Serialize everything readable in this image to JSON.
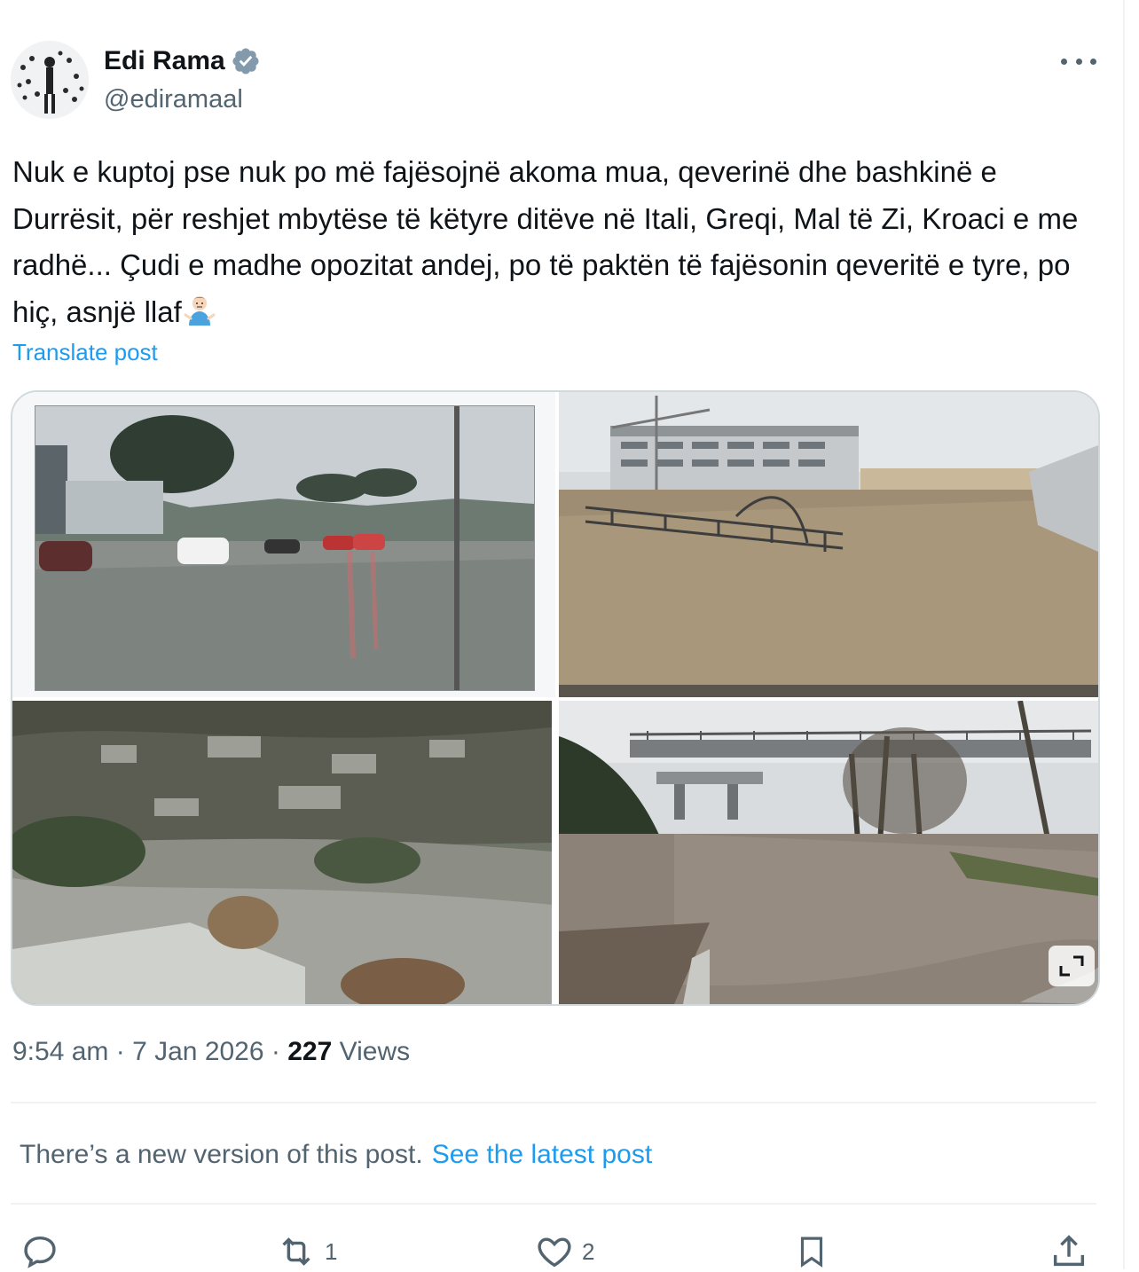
{
  "post": {
    "author": {
      "display_name": "Edi Rama",
      "handle": "@ediramaal",
      "verified": true
    },
    "text": "Nuk e kuptoj pse nuk po më fajësojnë akoma mua, qeverinë dhe bashkinë e Durrësit, për reshjet mbytëse të këtyre ditëve në Itali, Greqi, Mal të Zi, Kroaci e me radhë... Çudi e madhe opozitat andej, po të paktën të fajësonin qeveritë e tyre, po hiç, asnjë llaf",
    "emoji": "person-shrugging",
    "translate_label": "Translate post",
    "media": [
      {
        "name": "flooded-street-photo"
      },
      {
        "name": "flooded-building-lot-photo"
      },
      {
        "name": "flooded-valley-photo"
      },
      {
        "name": "flooded-underpass-photo"
      }
    ],
    "time": "9:54 am",
    "date": "7 Jan 2026",
    "views_count": "227",
    "views_label": "Views",
    "separator": "·"
  },
  "notice": {
    "text": "There’s a new version of this post.",
    "link": "See the latest post"
  },
  "actions": {
    "reply_count": "",
    "repost_count": "1",
    "like_count": "2"
  },
  "colors": {
    "link": "#1d9bf0",
    "secondary_text": "#536471",
    "primary_text": "#0f1419",
    "border": "#cfd9de"
  }
}
